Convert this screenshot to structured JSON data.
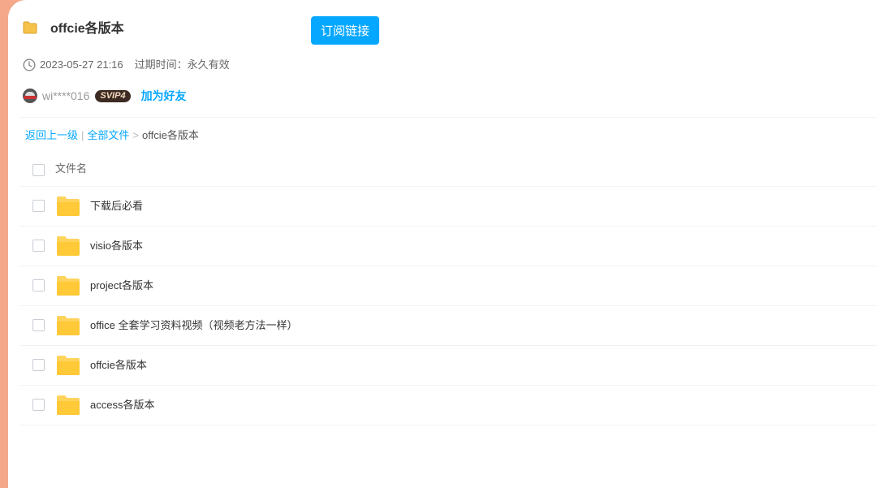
{
  "share": {
    "title": "offcie各版本",
    "subscribe_label": "订阅链接",
    "date": "2023-05-27 21:16",
    "expire_text": "过期时间：永久有效"
  },
  "user": {
    "name": "wi****016",
    "badge": "SVIP4",
    "add_friend_label": "加为好友"
  },
  "breadcrumb": {
    "back": "返回上一级",
    "separator_bar": "|",
    "all_files": "全部文件",
    "arrow": ">",
    "current": "offcie各版本"
  },
  "list": {
    "column_name": "文件名",
    "rows": [
      {
        "name": "下载后必看"
      },
      {
        "name": "visio各版本"
      },
      {
        "name": "project各版本"
      },
      {
        "name": "office 全套学习资料视频（视频老方法一样）"
      },
      {
        "name": "offcie各版本"
      },
      {
        "name": "access各版本"
      }
    ]
  },
  "colors": {
    "accent": "#06a7ff",
    "folder": "#ffd35c",
    "page_background": "#f5a98a"
  },
  "icons": [
    "folder-icon",
    "clock-icon",
    "avatar",
    "checkbox"
  ]
}
